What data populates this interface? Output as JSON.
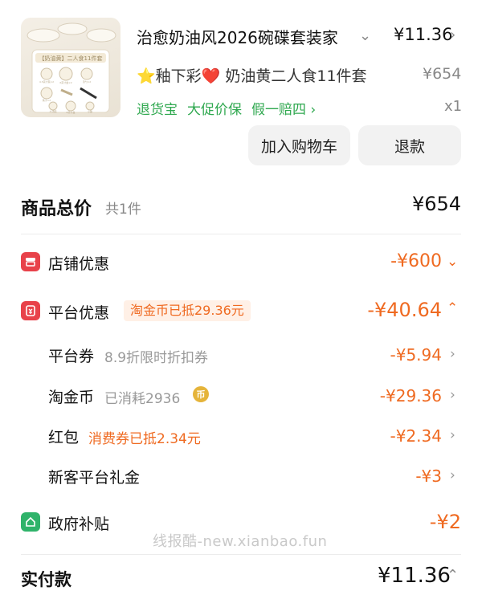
{
  "product": {
    "title": "治愈奶油风2026碗碟套装家",
    "price": "¥11.36",
    "sku": "⭐釉下彩❤️ 奶油黄二人食11件套",
    "sku_price": "¥654",
    "tags": [
      "退货宝",
      "大促价保",
      "假一赔四 ›"
    ],
    "qty": "x1",
    "thumb_caption": "【奶油黄】二人食11件套",
    "thumb_item_labels": [
      "4.5英寸碗×2",
      "6英寸盘×2",
      "汤勺×2",
      "筷子×2",
      "大汤碗",
      "8英寸盘",
      "小碟"
    ],
    "buttons": {
      "add_to_cart": "加入购物车",
      "refund": "退款"
    }
  },
  "total": {
    "label": "商品总价",
    "count": "共1件",
    "value": "¥654"
  },
  "shop_discount": {
    "label": "店铺优惠",
    "value": "-¥600"
  },
  "platform_discount": {
    "label": "平台优惠",
    "pill": "淘金币已抵29.36元",
    "value": "-¥40.64",
    "items": [
      {
        "label": "平台券",
        "hint": "8.9折限时折扣券",
        "value": "-¥5.94"
      },
      {
        "label": "淘金币",
        "hint": "已消耗2936",
        "value": "-¥29.36"
      },
      {
        "label": "红包",
        "hint": "消费券已抵2.34元",
        "value": "-¥2.34"
      },
      {
        "label": "新客平台礼金",
        "hint": "",
        "value": "-¥3"
      }
    ]
  },
  "gov_subsidy": {
    "label": "政府补贴",
    "value": "-¥2"
  },
  "watermark": "线报酷-new.xianbao.fun",
  "payment": {
    "label": "实付款",
    "value": "¥11.36"
  },
  "icons": {
    "shop": "store-icon",
    "platform": "platform-coupon-icon",
    "coin": "coin-icon",
    "gov": "home-icon"
  },
  "colors": {
    "accent": "#ef6a21",
    "green": "#2fa84f",
    "shop_icon": "#e8424a",
    "gov_icon": "#2fb36a"
  }
}
